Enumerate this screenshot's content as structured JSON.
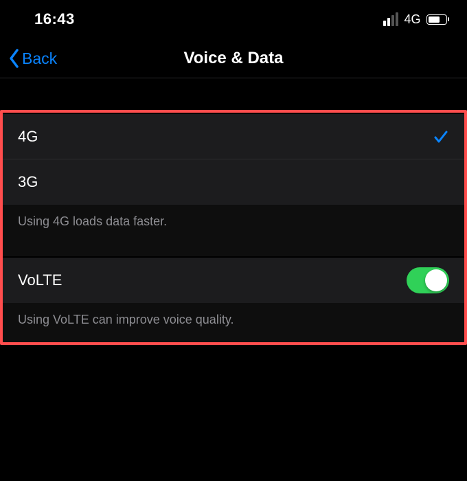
{
  "status": {
    "time": "16:43",
    "network_label": "4G"
  },
  "nav": {
    "back_label": "Back",
    "title": "Voice & Data"
  },
  "network_options_group": {
    "items": [
      {
        "label": "4G",
        "selected": true
      },
      {
        "label": "3G",
        "selected": false
      }
    ],
    "footer": "Using 4G loads data faster."
  },
  "volte_group": {
    "label": "VoLTE",
    "enabled": true,
    "footer": "Using VoLTE can improve voice quality."
  }
}
